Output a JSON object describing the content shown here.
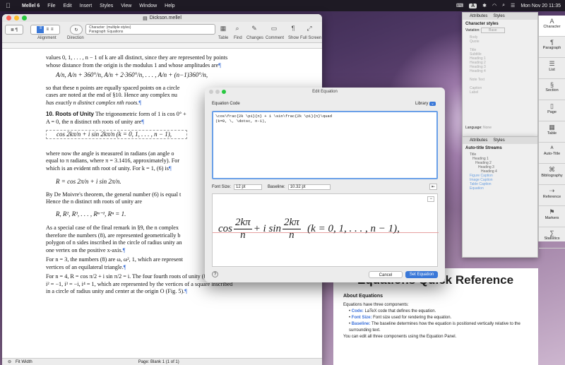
{
  "menubar": {
    "app": "Mellel 6",
    "items": [
      "File",
      "Edit",
      "Insert",
      "Styles",
      "View",
      "Window",
      "Help"
    ],
    "badge": "A",
    "datetime": "Mon Nov 20 11:35"
  },
  "window": {
    "title": "Dickson.mellel",
    "status_zoom": "Fit Width",
    "status_page": "Page: Blank 1 (1 of 1)"
  },
  "toolbar": {
    "alignment": "Alignment",
    "direction": "Direction",
    "style_line1": "Character: (multiple styles)",
    "style_line2": "Paragraph: Equations",
    "table": "Table",
    "find": "Find",
    "changes": "Changes",
    "comment": "Comment",
    "show": "Show",
    "full_screen": "Full Screen"
  },
  "doc": {
    "p1a": "values 0, 1, . . . , n − 1 of k are all distinct, since they are represented by points",
    "p1b": "whose distance from the origin is the modulus 1 and whose amplitudes are",
    "p1math": "A/n,   A/n + 360°/n,   A/n + 2·360°/n, . . . ,   A/n + (n−1)360°/n,",
    "p2a": "so that these n points are equally spaced points on a circle",
    "p2b": "cases are noted at the end of §10. Hence any complex nu",
    "p2c": "has exactly n distinct complex nth roots.",
    "h10": "10. Roots of Unity",
    "p3a": " The trigonometric form of 1 is cos 0° +",
    "p3b": "A = 0, the n distinct nth roots of unity are",
    "p3math": "cos 2kπ/n + i sin 2kπ/n  (k = 0, 1, . . . , n − 1),",
    "p4a": "where now the angle is measured in radians (an angle o",
    "p4b": "equal to π radians, where π = 3.1416, approximately). For",
    "p4c": "which is an evident nth root of unity. For k = 1, (6) is",
    "p4math": "R = cos 2π/n + i sin 2π/n.",
    "p5a": "By De Moivre's theorem, the general number (6) is equal t",
    "p5b": "Hence the n distinct nth roots of unity are",
    "p5math": "R,  R², R³, . . . , Rⁿ⁻¹,  Rⁿ = 1.",
    "p6a": "As a special case of the final remark in §9, the n complex",
    "p6b": "therefore the numbers (8), are represented geometrically b",
    "p6c": "polygon of n sides inscribed in the circle of radius unity an",
    "p6d": "one vertex on the positive x-axis.",
    "p7a": "For n = 3, the numbers (8) are ω, ω², 1, which are represent",
    "p7b": "vertices of an equilateral triangle.",
    "p8a": "For n = 4, R = cos π/2 + i sin π/2 = i. The four fourth roots of unity (8) are i,",
    "p8b": "i² = −1, i³ = −i, i⁴ = 1, which are represented by the vertices of a square inscribed",
    "p8c": "in a circle of radius unity and center at the origin O (Fig. 5)."
  },
  "attributes": {
    "tab1": "Attributes",
    "tab2": "Styles",
    "title": "Character styles",
    "variation_label": "Variation:",
    "variation_value": "Base",
    "styles": [
      "Body",
      "Quote",
      "",
      "Title",
      "Subtitle",
      "Heading 1",
      "Heading 2",
      "Heading 3",
      "Heading 4",
      "",
      "Note Text",
      "",
      "Caption",
      "Label"
    ],
    "language_label": "Language:",
    "language_value": "None"
  },
  "autotitle": {
    "tab1": "Attributes",
    "tab2": "Styles",
    "title": "Auto-title Streams",
    "items": [
      "Title",
      "Heading 1",
      "Heading 2",
      "Heading 3",
      "Heading 4",
      "Figure Caption",
      "Image Caption",
      "Table Caption",
      "Equation"
    ]
  },
  "sidebar": [
    "Character",
    "Paragraph",
    "List",
    "Section",
    "Page",
    "Table",
    "Auto-Title",
    "Bibliography",
    "Reference",
    "Markers",
    "Statistics"
  ],
  "dialog": {
    "title": "Edit Equation",
    "code_label": "Equation Code",
    "library": "Library",
    "code": "\\cos\\frac{2k \\pi}{n} + i \\sin\\frac{2k \\pi}{n}\\quad\n(k=0, \\, \\dotsc, n-1),",
    "font_size_label": "Font Size:",
    "font_size": "12 pt",
    "baseline_label": "Baseline:",
    "baseline": "10.32 pt",
    "cancel": "Cancel",
    "set": "Set Equation"
  },
  "reference": {
    "title": "Equations Quick Reference",
    "heading": "About Equations",
    "intro": "Equations have three components:",
    "code_term": "Code:",
    "code_text": "LaTeX code that defines the equation.",
    "fs_term": "Font Size:",
    "fs_text": "Font size used for rendering the equation.",
    "bl_term": "Baseline:",
    "bl_text": "The baseline determines how the equation is positioned vertically relative to the surrounding text.",
    "outro": "You can edit all three components using the Equation Panel."
  }
}
